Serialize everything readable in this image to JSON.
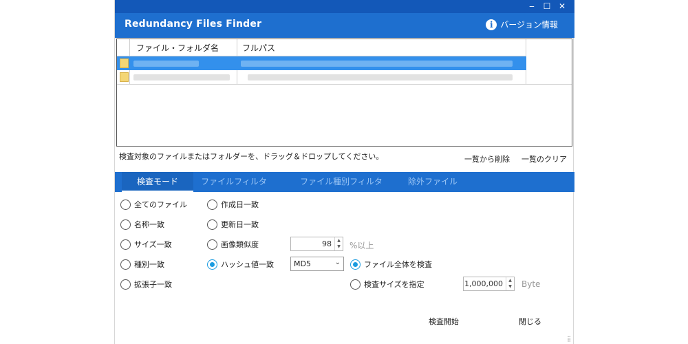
{
  "window": {
    "title": "Redundancy Files Finder",
    "version_label": "バージョン情報",
    "controls": {
      "minimize": "‒",
      "maximize": "☐",
      "close": "✕"
    }
  },
  "filelist": {
    "columns": [
      "ファイル・フォルダ名",
      "フルパス"
    ],
    "rows": [
      {
        "selected": true
      },
      {
        "selected": false
      }
    ]
  },
  "hint": "検査対象のファイルまたはフォルダーを、ドラッグ＆ドロップしてください。",
  "list_actions": {
    "remove": "一覧から削除",
    "clear": "一覧のクリア"
  },
  "tabs": [
    {
      "label": "検査モード",
      "active": true
    },
    {
      "label": "ファイルフィルタ",
      "active": false
    },
    {
      "label": "ファイル種別フィルタ",
      "active": false
    },
    {
      "label": "除外ファイル",
      "active": false
    }
  ],
  "modes": {
    "all_files": "全てのファイル",
    "name_match": "名称一致",
    "size_match": "サイズ一致",
    "type_match": "種別一致",
    "ext_match": "拡張子一致",
    "created_match": "作成日一致",
    "modified_match": "更新日一致",
    "image_similarity": "画像類似度",
    "hash_match": "ハッシュ値一致"
  },
  "selected_mode": "hash_match",
  "similarity": {
    "value": "98",
    "unit": "%以上"
  },
  "hash": {
    "algorithm": "MD5"
  },
  "hash_scope": {
    "whole_file": "ファイル全体を検査",
    "partial": "検査サイズを指定",
    "selected": "whole_file"
  },
  "inspect_size": {
    "value": "1,000,000",
    "unit": "Byte"
  },
  "actions": {
    "start": "検査開始",
    "close": "閉じる"
  },
  "colors": {
    "titlebar": "#1358b8",
    "header": "#1e6fcf",
    "selection": "#3390ec",
    "radio_accent": "#1a9be0"
  }
}
